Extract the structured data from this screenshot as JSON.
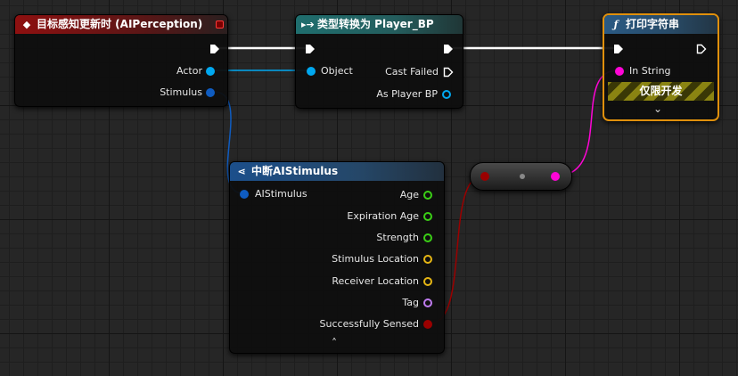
{
  "theme": {
    "exec_color": "#ffffff",
    "object_color": "#00a8f0",
    "struct_color": "#0f5cc0",
    "float_color": "#3bd016",
    "vector_color": "#e6b614",
    "name_color": "#c07cf0",
    "bool_color": "#9a0000",
    "string_color": "#ff05d6"
  },
  "nodes": {
    "event": {
      "title": "目标感知更新时 (AIPerception)",
      "pins": {
        "actor": "Actor",
        "stimulus": "Stimulus"
      }
    },
    "cast": {
      "title": "类型转换为 Player_BP",
      "icon": "cast-icon",
      "pins": {
        "object": "Object",
        "cast_failed": "Cast Failed",
        "as_player": "As Player BP"
      }
    },
    "print": {
      "title": "打印字符串",
      "icon": "function-icon",
      "pins": {
        "in_string": "In String"
      },
      "dev_only": "仅限开发"
    },
    "break": {
      "title": "中断AIStimulus",
      "icon": "break-struct-icon",
      "input": "AIStimulus",
      "outputs": [
        "Age",
        "Expiration Age",
        "Strength",
        "Stimulus Location",
        "Receiver Location",
        "Tag",
        "Successfully Sensed"
      ]
    },
    "conversion": {
      "type": "bool-to-string-conversion"
    }
  }
}
